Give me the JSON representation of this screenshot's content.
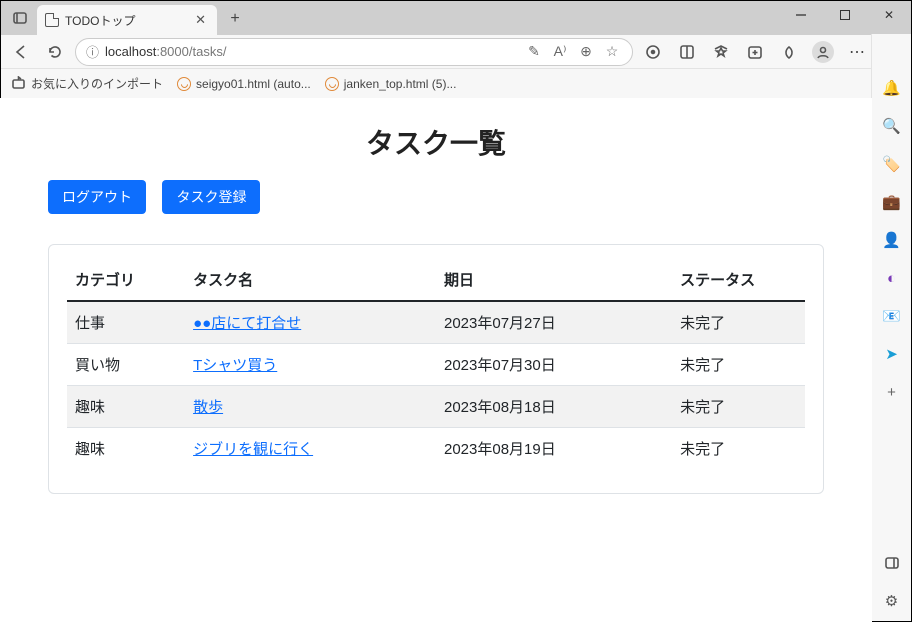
{
  "browser": {
    "tab_title": "TODOトップ",
    "url_host": "localhost",
    "url_port": "8000",
    "url_path": "/tasks/"
  },
  "bookmarks": {
    "import_label": "お気に入りのインポート",
    "items": [
      "seigyo01.html (auto...",
      "janken_top.html (5)..."
    ]
  },
  "page": {
    "title": "タスク一覧",
    "logout_label": "ログアウト",
    "register_label": "タスク登録"
  },
  "table": {
    "headers": {
      "category": "カテゴリ",
      "name": "タスク名",
      "due": "期日",
      "status": "ステータス"
    },
    "rows": [
      {
        "category": "仕事",
        "name": "●●店にて打合せ",
        "due": "2023年07月27日",
        "status": "未完了"
      },
      {
        "category": "買い物",
        "name": "Tシャツ買う",
        "due": "2023年07月30日",
        "status": "未完了"
      },
      {
        "category": "趣味",
        "name": "散歩",
        "due": "2023年08月18日",
        "status": "未完了"
      },
      {
        "category": "趣味",
        "name": "ジブリを観に行く",
        "due": "2023年08月19日",
        "status": "未完了"
      }
    ]
  }
}
